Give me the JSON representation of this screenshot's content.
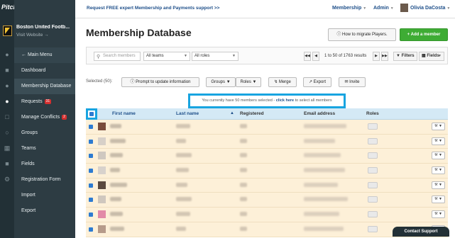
{
  "brand": "Pitchero",
  "club": {
    "name": "Boston United Footb...",
    "visit_label": "Visit Website →"
  },
  "nav": [
    {
      "label": "← Main Menu",
      "badge": ""
    },
    {
      "label": "Dashboard",
      "badge": ""
    },
    {
      "label": "Membership Database",
      "badge": ""
    },
    {
      "label": "Requests",
      "badge": "31"
    },
    {
      "label": "Manage Conflicts",
      "badge": "2"
    },
    {
      "label": "Groups",
      "badge": ""
    },
    {
      "label": "Teams",
      "badge": ""
    },
    {
      "label": "Fields",
      "badge": ""
    },
    {
      "label": "Registration Form",
      "badge": ""
    },
    {
      "label": "Import",
      "badge": ""
    },
    {
      "label": "Export",
      "badge": ""
    }
  ],
  "topbar": {
    "support_link": "Request FREE expert Membership and Payments support >>",
    "membership_menu": "Membership",
    "admin_menu": "Admin",
    "user_name": "Olivia DaCosta"
  },
  "header": {
    "title": "Membership Database",
    "migrate_button": "ⓘ How to migrate Players.",
    "add_member_button": "+ Add a member"
  },
  "filters": {
    "search_placeholder": "Search members",
    "teams_select": "All teams",
    "roles_select": "All roles",
    "results_text": "1 to 50 of 1763 results",
    "filters_button": "Filters",
    "fields_button": "Fields"
  },
  "actions": {
    "selected_count": "Selected (50):",
    "prompt_button": "Prompt to update information",
    "groups_button": "Groups",
    "roles_button": "Roles",
    "merge_button": "Merge",
    "export_button": "Export",
    "invite_button": "Invite"
  },
  "notice": {
    "text_before": "You currently have 50 members selected - ",
    "link": "click here",
    "text_after": " to select all members"
  },
  "table": {
    "columns": [
      "First name",
      "Last name",
      "Registered",
      "Email address",
      "Roles"
    ],
    "row_count": 8
  },
  "support_label": "Contact Support"
}
